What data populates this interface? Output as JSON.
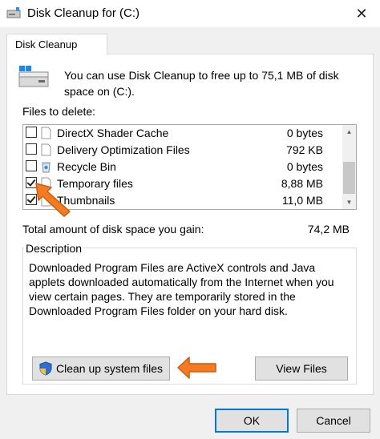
{
  "window": {
    "title": "Disk Cleanup for  (C:)",
    "close_glyph": "✕"
  },
  "tab": {
    "label": "Disk Cleanup"
  },
  "info": {
    "text": "You can use Disk Cleanup to free up to 75,1 MB of disk space on  (C:)."
  },
  "files": {
    "label": "Files to delete:",
    "items": [
      {
        "name": "DirectX Shader Cache",
        "size": "0 bytes",
        "checked": false,
        "icon": "file-icon"
      },
      {
        "name": "Delivery Optimization Files",
        "size": "792 KB",
        "checked": false,
        "icon": "file-icon"
      },
      {
        "name": "Recycle Bin",
        "size": "0 bytes",
        "checked": false,
        "icon": "recycle-bin-icon"
      },
      {
        "name": "Temporary files",
        "size": "8,88 MB",
        "checked": true,
        "icon": "file-icon"
      },
      {
        "name": "Thumbnails",
        "size": "11,0 MB",
        "checked": true,
        "icon": "file-icon"
      }
    ]
  },
  "total": {
    "label": "Total amount of disk space you gain:",
    "value": "74,2 MB"
  },
  "description": {
    "title": "Description",
    "text": "Downloaded Program Files are ActiveX controls and Java applets downloaded automatically from the Internet when you view certain pages. They are temporarily stored in the Downloaded Program Files folder on your hard disk."
  },
  "buttons": {
    "cleanup": "Clean up system files",
    "view_files": "View Files",
    "ok": "OK",
    "cancel": "Cancel"
  },
  "colors": {
    "accent": "#0078d7",
    "arrow": "#f47b20"
  }
}
